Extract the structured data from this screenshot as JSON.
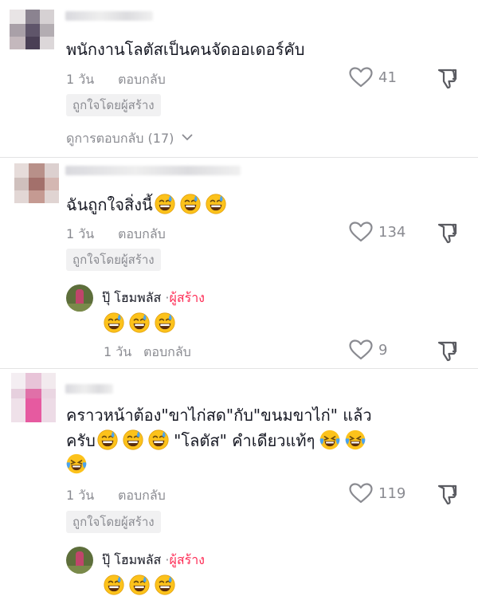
{
  "comments": [
    {
      "text": "พนักงานโลตัสเป็นคนจัดออเดอร์คับ",
      "time": "1 วัน",
      "reply_label": "ตอบกลับ",
      "liked_badge": "ถูกใจโดยผู้สร้าง",
      "likes": "41",
      "view_replies": "ดูการตอบกลับ (17)"
    },
    {
      "text": "ฉันถูกใจสิ่งนี้",
      "time": "1 วัน",
      "reply_label": "ตอบกลับ",
      "liked_badge": "ถูกใจโดยผู้สร้าง",
      "likes": "134",
      "reply": {
        "name": "ปุ๊ โฮมพลัส",
        "separator": "·",
        "creator_label": "ผู้สร้าง",
        "time": "1 วัน",
        "reply_label": "ตอบกลับ",
        "likes": "9"
      }
    },
    {
      "text_line1": "คราวหน้าต้อง\"ขาไก่สด\"กับ\"ขนมขาไก่\" แล้ว",
      "text_line2a": "ครับ",
      "text_line2b": " \"โลตัส\" คำเดียวแท้ๆ",
      "time": "1 วัน",
      "reply_label": "ตอบกลับ",
      "liked_badge": "ถูกใจโดยผู้สร้าง",
      "likes": "119",
      "reply": {
        "name": "ปุ๊ โฮมพลัส",
        "separator": "·",
        "creator_label": "ผู้สร้าง"
      }
    }
  ],
  "icons": {
    "heart": "heart-outline-icon",
    "dislike": "thumbs-down-icon",
    "chevron": "chevron-down-icon",
    "emoji_sweat": "grinning-sweat-emoji"
  },
  "colors": {
    "text": "#161823",
    "muted": "#8a8b91",
    "creator": "#fe2c55",
    "badge_bg": "#f1f1f2"
  }
}
